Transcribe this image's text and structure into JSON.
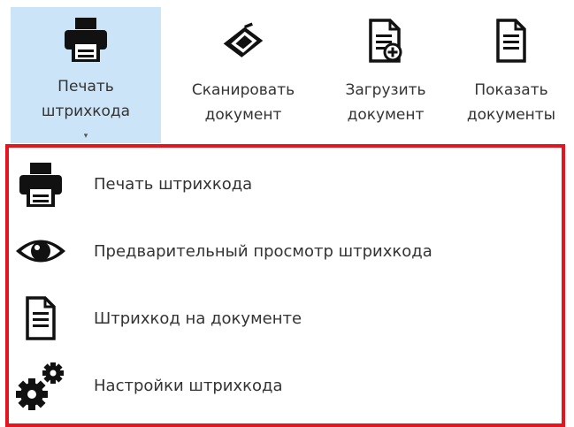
{
  "ribbon": {
    "buttons": [
      {
        "line1": "Печать",
        "line2": "штрихкода",
        "icon": "printer-icon",
        "has_dropdown": true,
        "active": true
      },
      {
        "line1": "Сканировать",
        "line2": "документ",
        "icon": "scanner-icon"
      },
      {
        "line1": "Загрузить",
        "line2": "документ",
        "icon": "document-add-icon"
      },
      {
        "line1": "Показать",
        "line2": "документы",
        "icon": "document-icon"
      }
    ],
    "dropdown_caret": "▾"
  },
  "menu": {
    "items": [
      {
        "label": "Печать штрихкода",
        "icon": "printer-icon"
      },
      {
        "label": "Предварительный просмотр штрихкода",
        "icon": "eye-icon"
      },
      {
        "label": "Штрихкод на документе",
        "icon": "document-icon"
      },
      {
        "label": "Настройки штрихкода",
        "icon": "gears-icon"
      }
    ]
  },
  "colors": {
    "active_button_bg": "#cce4f7",
    "highlight_border": "#e5141e",
    "icon_color": "#111111"
  }
}
